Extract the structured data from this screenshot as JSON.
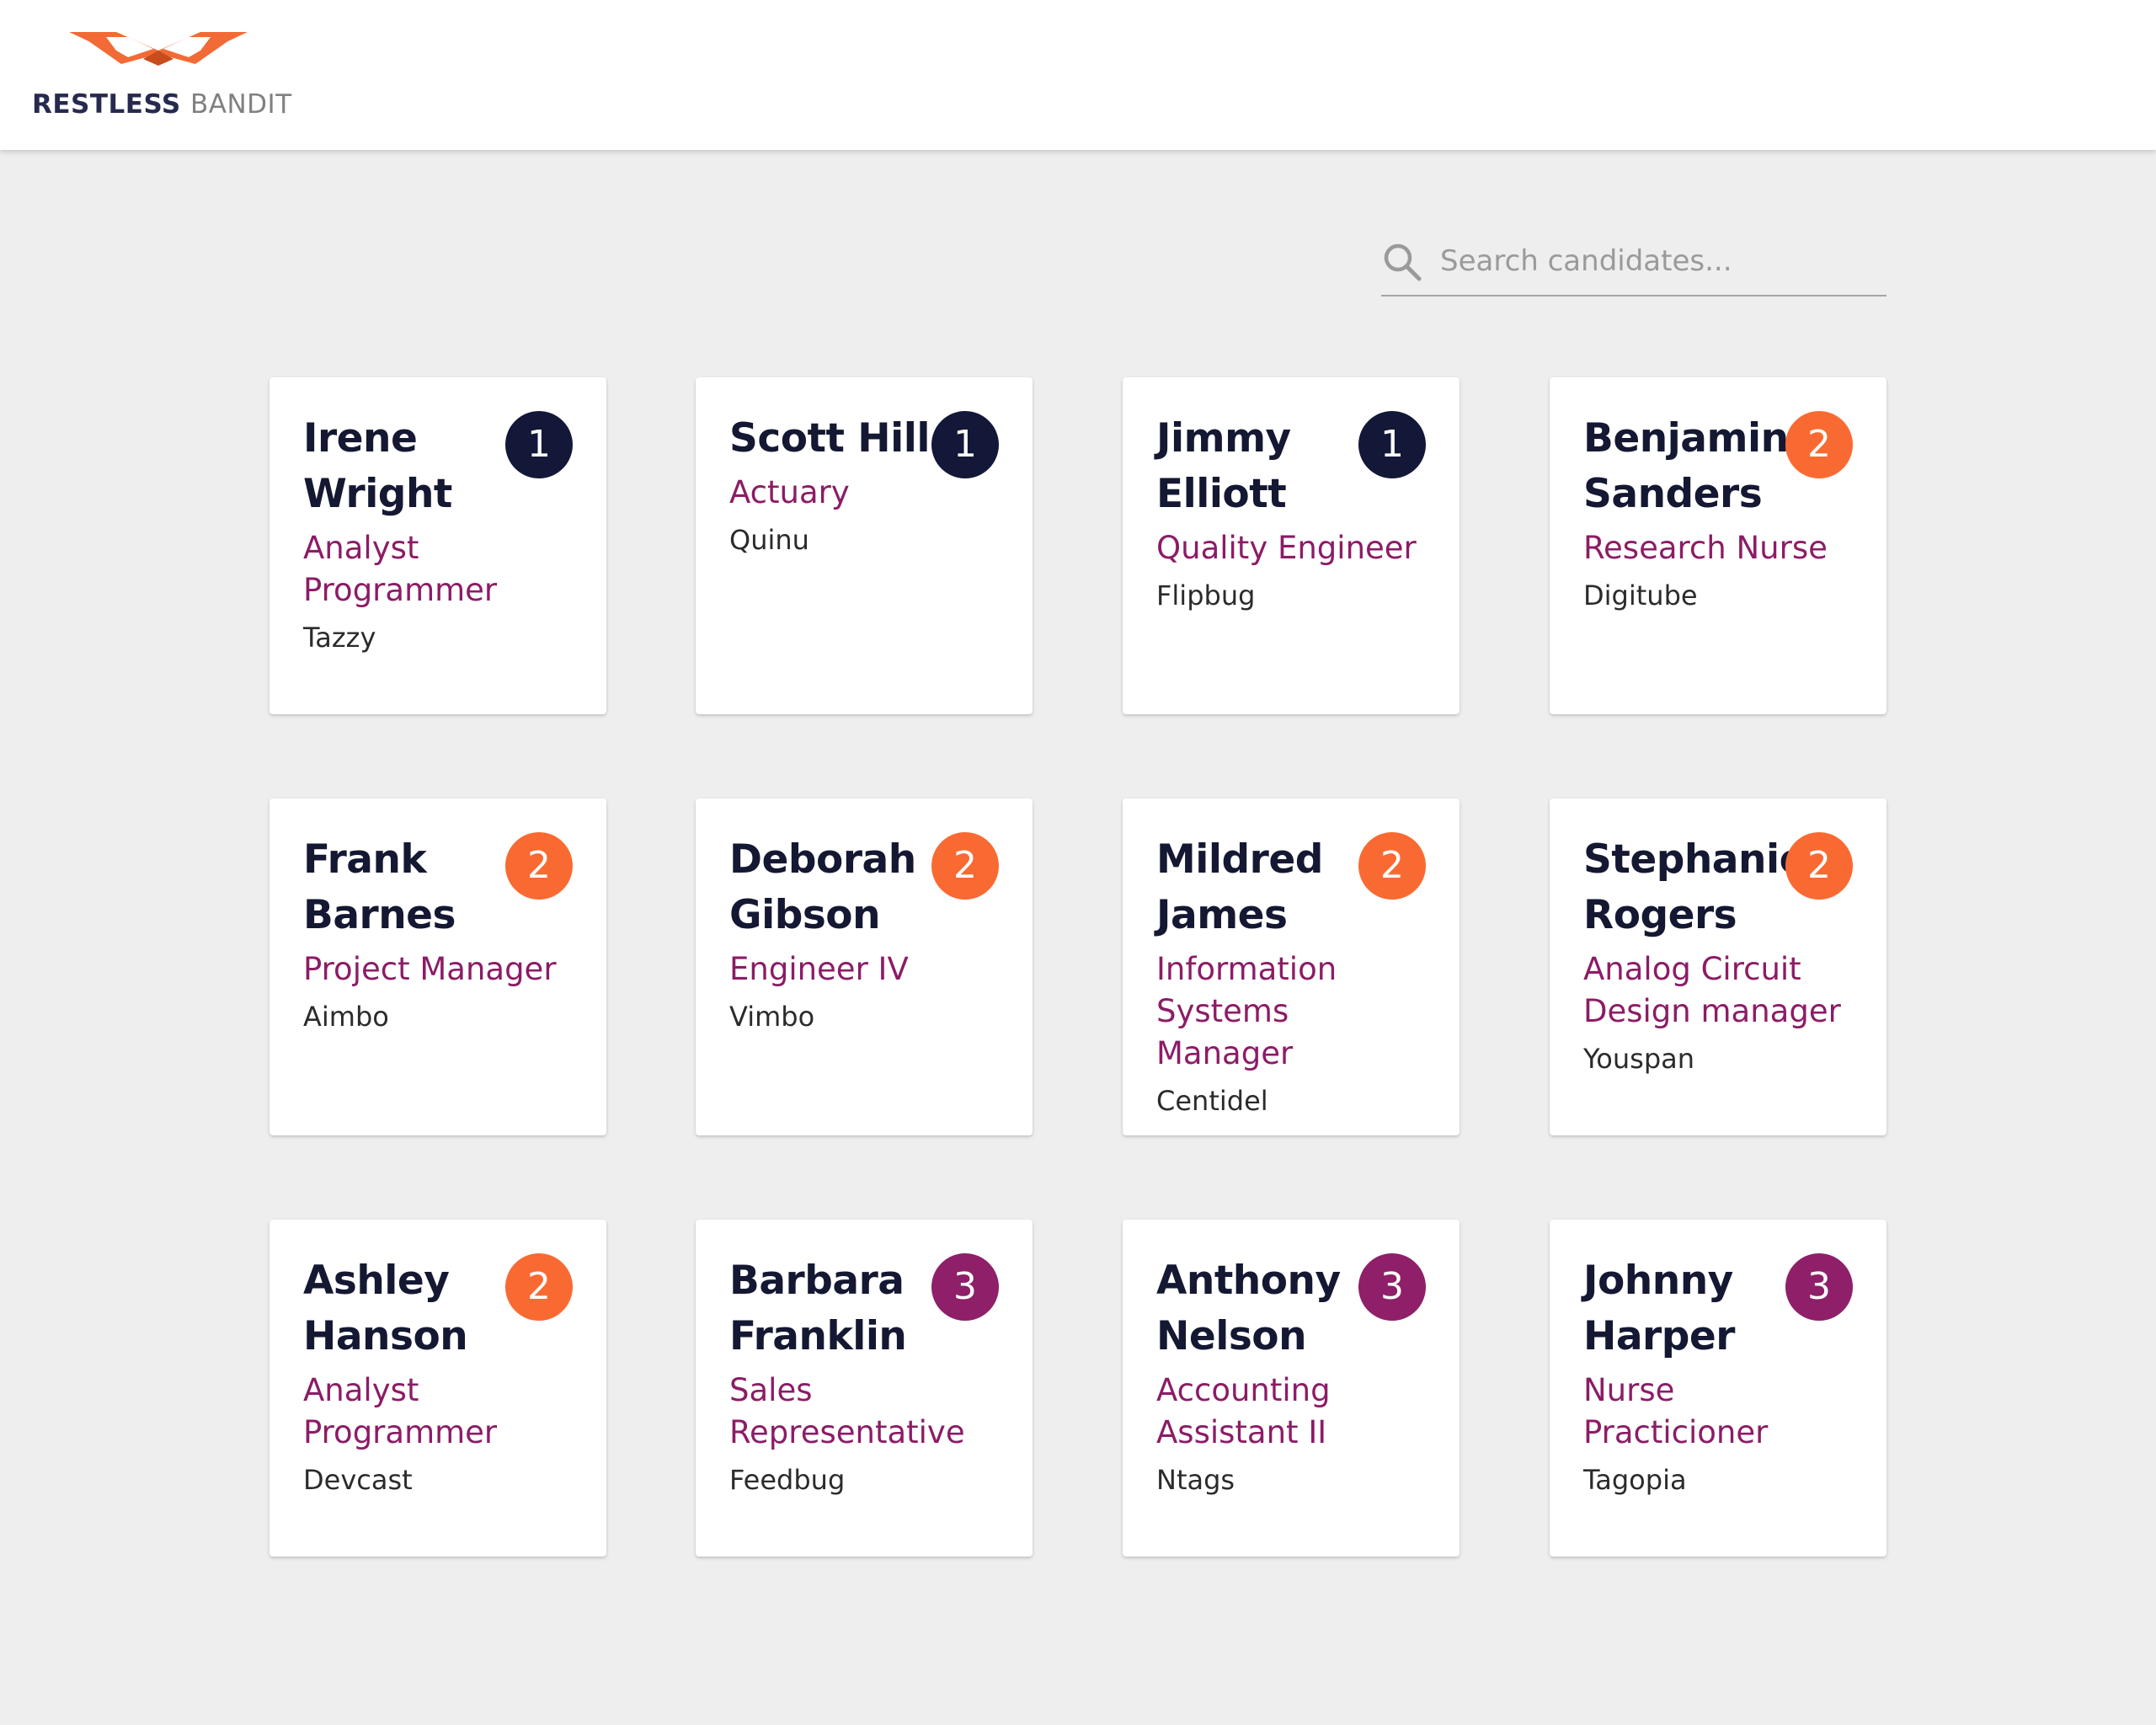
{
  "brand": {
    "name_part1": "RESTLESS",
    "name_part2": "BANDIT",
    "logo_icon": "bandit-mask-icon",
    "colors": {
      "orange": "#f26a35",
      "navy": "#262a4f",
      "gray": "#808080"
    }
  },
  "search": {
    "placeholder": "Search candidates...",
    "value": "",
    "icon": "search-icon"
  },
  "badge_colors": {
    "1": "#131738",
    "2": "#f96a32",
    "3": "#8e1f68"
  },
  "candidates": [
    {
      "name": "Irene Wright",
      "title": "Analyst Programmer",
      "company": "Tazzy",
      "rank": "1"
    },
    {
      "name": "Scott Hill",
      "title": "Actuary",
      "company": "Quinu",
      "rank": "1"
    },
    {
      "name": "Jimmy Elliott",
      "title": "Quality Engineer",
      "company": "Flipbug",
      "rank": "1"
    },
    {
      "name": "Benjamin Sanders",
      "title": "Research Nurse",
      "company": "Digitube",
      "rank": "2"
    },
    {
      "name": "Frank Barnes",
      "title": "Project Manager",
      "company": "Aimbo",
      "rank": "2"
    },
    {
      "name": "Deborah Gibson",
      "title": "Engineer IV",
      "company": "Vimbo",
      "rank": "2"
    },
    {
      "name": "Mildred James",
      "title": "Information Systems Manager",
      "company": "Centidel",
      "rank": "2"
    },
    {
      "name": "Stephanie Rogers",
      "title": "Analog Circuit Design manager",
      "company": "Youspan",
      "rank": "2"
    },
    {
      "name": "Ashley Hanson",
      "title": "Analyst Programmer",
      "company": "Devcast",
      "rank": "2"
    },
    {
      "name": "Barbara Franklin",
      "title": "Sales Representative",
      "company": "Feedbug",
      "rank": "3"
    },
    {
      "name": "Anthony Nelson",
      "title": "Accounting Assistant II",
      "company": "Ntags",
      "rank": "3"
    },
    {
      "name": "Johnny Harper",
      "title": "Nurse Practicioner",
      "company": "Tagopia",
      "rank": "3"
    }
  ]
}
